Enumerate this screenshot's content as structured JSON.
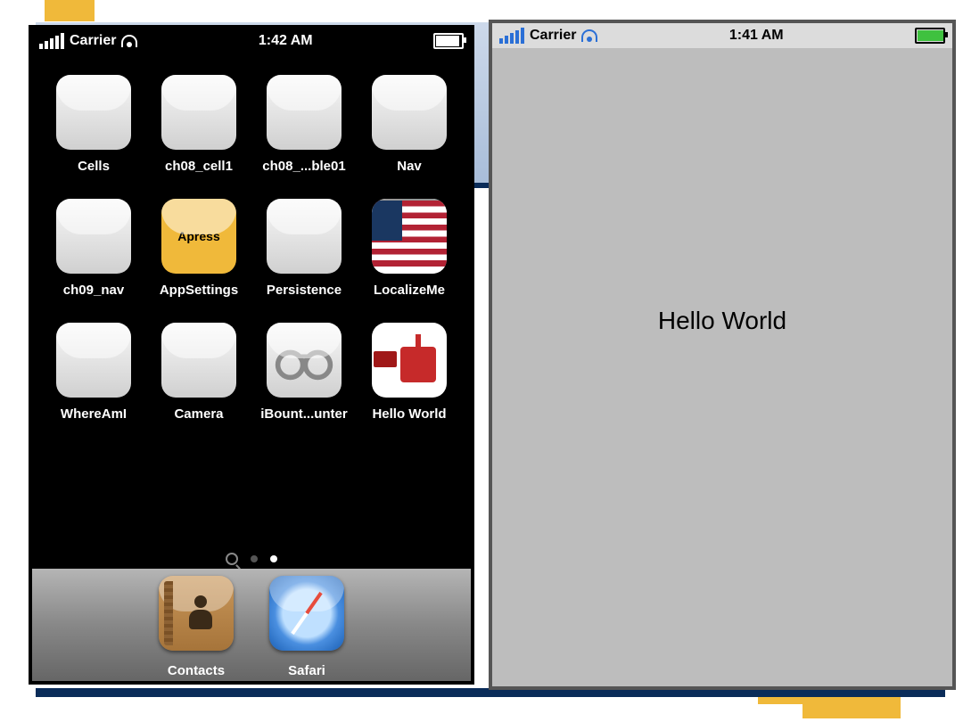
{
  "left": {
    "statusbar": {
      "carrier": "Carrier",
      "time": "1:42 AM"
    },
    "apps": [
      {
        "label": "Cells",
        "icon": "blank"
      },
      {
        "label": "ch08_cell1",
        "icon": "blank"
      },
      {
        "label": "ch08_...ble01",
        "icon": "blank"
      },
      {
        "label": "Nav",
        "icon": "blank"
      },
      {
        "label": "ch09_nav",
        "icon": "blank"
      },
      {
        "label": "AppSettings",
        "icon": "apress",
        "text": "Apress"
      },
      {
        "label": "Persistence",
        "icon": "blank"
      },
      {
        "label": "LocalizeMe",
        "icon": "flag"
      },
      {
        "label": "WhereAmI",
        "icon": "blank"
      },
      {
        "label": "Camera",
        "icon": "blank"
      },
      {
        "label": "iBount...unter",
        "icon": "cuffs"
      },
      {
        "label": "Hello World",
        "icon": "gift"
      }
    ],
    "dock": [
      {
        "label": "Contacts",
        "icon": "contacts"
      },
      {
        "label": "Safari",
        "icon": "safari"
      }
    ]
  },
  "right": {
    "statusbar": {
      "carrier": "Carrier",
      "time": "1:41 AM"
    },
    "content": "Hello World"
  }
}
